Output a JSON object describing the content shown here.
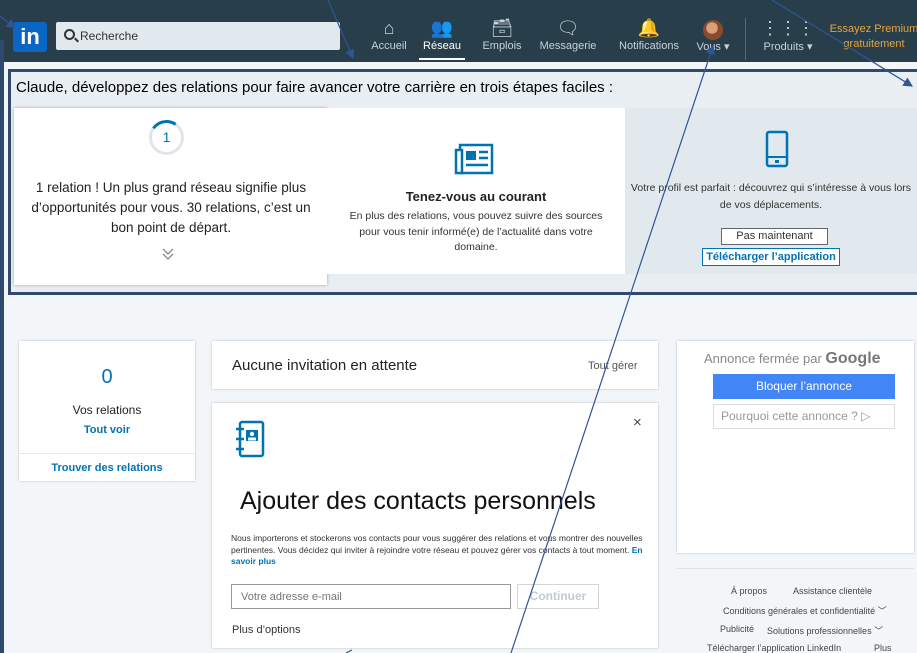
{
  "nav": {
    "logo": "in",
    "search_placeholder": "Recherche",
    "items": [
      {
        "label": "Accueil"
      },
      {
        "label": "Réseau"
      },
      {
        "label": "Emplois"
      },
      {
        "label": "Messagerie"
      },
      {
        "label": "Notifications"
      },
      {
        "label": "Vous ▾"
      },
      {
        "label": "Produits ▾"
      }
    ],
    "premium_line1": "Essayez Premium",
    "premium_line2": "gratuitement"
  },
  "steps": {
    "title": "Claude, développez des relations pour faire avancer votre carrière en trois étapes faciles :",
    "card1": {
      "count": "1",
      "text": "1 relation ! Un plus grand réseau signifie plus d’opportunités pour vous. 30 relations, c’est un bon point de départ."
    },
    "card2": {
      "title": "Tenez-vous au courant",
      "text": "En plus des relations, vous pouvez suivre des sources pour vous tenir informé(e) de l’actualité dans votre domaine."
    },
    "card3": {
      "text": "Votre profil est parfait : découvrez qui s’intéresse à vous lors de vos déplacements.",
      "not_now": "Pas maintenant",
      "download": "Télécharger l’application"
    }
  },
  "relations": {
    "count": "0",
    "label": "Vos relations",
    "see_all": "Tout voir",
    "find": "Trouver des relations"
  },
  "invitations": {
    "title": "Aucune invitation en attente",
    "manage": "Tout gérer"
  },
  "contacts": {
    "title": "Ajouter des contacts personnels",
    "text": "Nous importerons et stockerons vos contacts pour vous suggérer des relations et vous montrer des nouvelles pertinentes. Vous décidez qui inviter à rejoindre votre réseau et pouvez gérer vos contacts à tout moment.",
    "link": "En savoir plus",
    "email_placeholder": "Votre adresse e-mail",
    "continue": "Continuer",
    "more_options": "Plus d’options",
    "close": "×"
  },
  "ad": {
    "closed_by": "Annonce fermée par",
    "google": "Google",
    "block": "Bloquer l’annonce",
    "why": "Pourquoi cette annonce ? ▷"
  },
  "footer": {
    "about": "À propos",
    "help": "Assistance clientèle",
    "terms": "Conditions générales et confidentialité ﹀",
    "ads": "Publicité",
    "solutions": "Solutions professionnelles ﹀",
    "app": "Télécharger l’application LinkedIn",
    "more": "Plus"
  }
}
